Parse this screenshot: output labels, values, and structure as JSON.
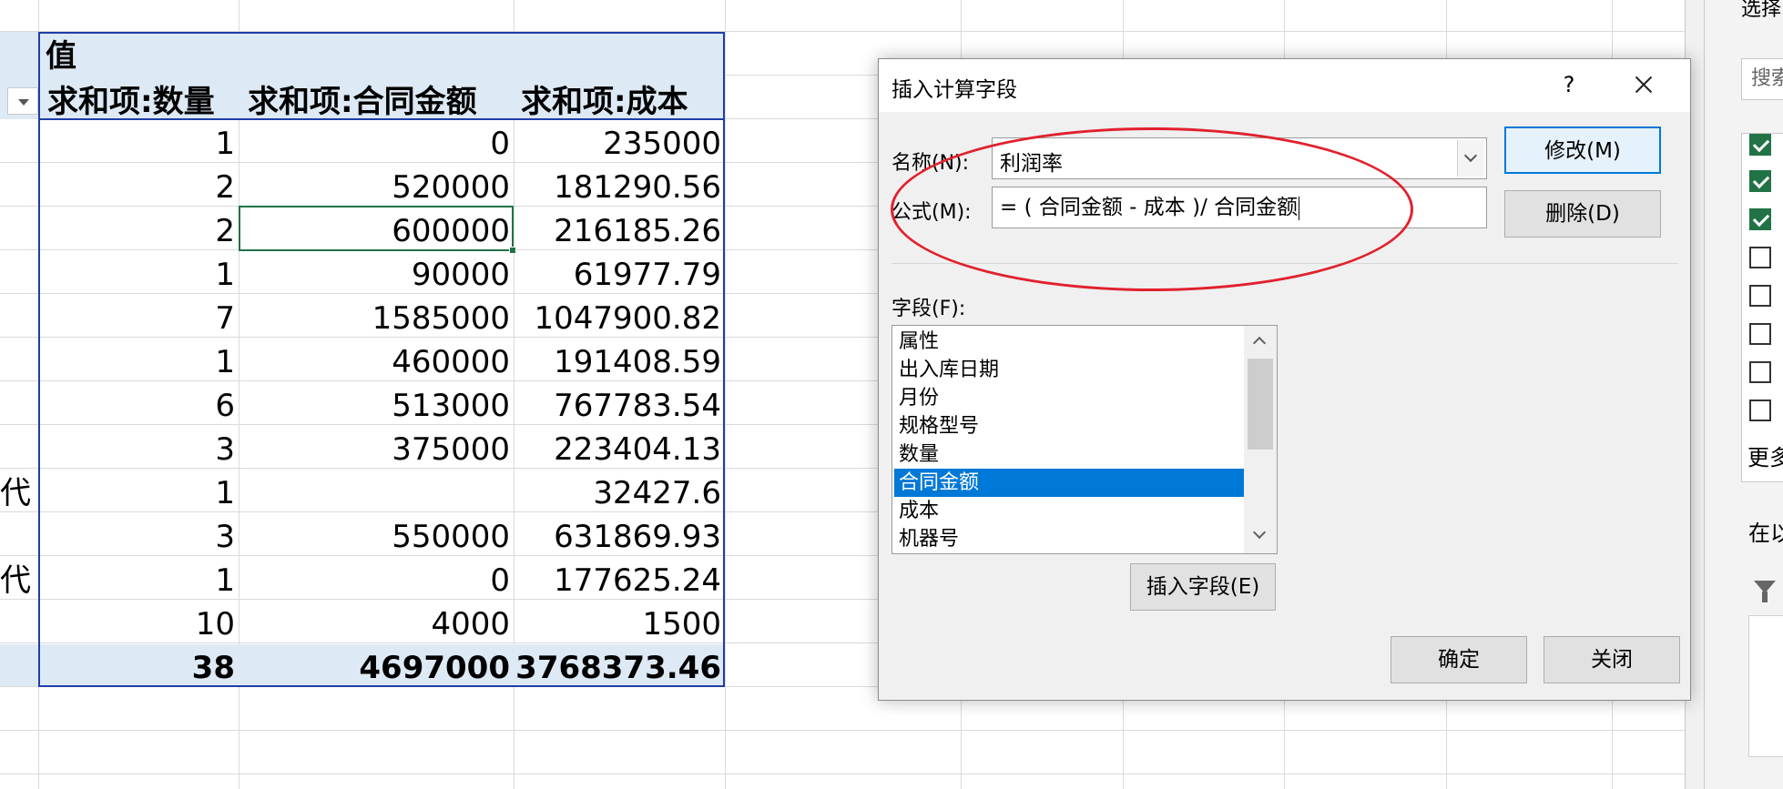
{
  "pivot": {
    "values_header": "值",
    "columns": [
      "求和项:数量",
      "求和项:合同金额",
      "求和项:成本"
    ],
    "rows": [
      {
        "label": "",
        "qty": "1",
        "amount": "0",
        "cost": "235000"
      },
      {
        "label": "",
        "qty": "2",
        "amount": "520000",
        "cost": "181290.56"
      },
      {
        "label": "",
        "qty": "2",
        "amount": "600000",
        "cost": "216185.26"
      },
      {
        "label": "",
        "qty": "1",
        "amount": "90000",
        "cost": "61977.79"
      },
      {
        "label": "",
        "qty": "7",
        "amount": "1585000",
        "cost": "1047900.82"
      },
      {
        "label": "",
        "qty": "1",
        "amount": "460000",
        "cost": "191408.59"
      },
      {
        "label": "",
        "qty": "6",
        "amount": "513000",
        "cost": "767783.54"
      },
      {
        "label": "",
        "qty": "3",
        "amount": "375000",
        "cost": "223404.13"
      },
      {
        "label": "代",
        "qty": "1",
        "amount": "",
        "cost": "32427.6"
      },
      {
        "label": "",
        "qty": "3",
        "amount": "550000",
        "cost": "631869.93"
      },
      {
        "label": "代",
        "qty": "1",
        "amount": "0",
        "cost": "177625.24"
      },
      {
        "label": "",
        "qty": "10",
        "amount": "4000",
        "cost": "1500"
      }
    ],
    "total": {
      "qty": "38",
      "amount": "4697000",
      "cost": "3768373.46"
    },
    "header_color": "#dde9f5",
    "border_color": "#1f3ea8"
  },
  "dialog": {
    "title": "插入计算字段",
    "help": "?",
    "name_label": "名称(N):",
    "name_value": "利润率",
    "formula_label": "公式(M):",
    "formula_value": "= ( 合同金额 - 成本 )/ 合同金额",
    "fields_label": "字段(F):",
    "fields": [
      "属性",
      "出入库日期",
      "月份",
      "规格型号",
      "数量",
      "合同金额",
      "成本",
      "机器号"
    ],
    "selected_field": "合同金额",
    "buttons": {
      "modify": "修改(M)",
      "delete": "删除(D)",
      "insert_field": "插入字段(E)",
      "ok": "确定",
      "close": "关闭"
    },
    "selection_color": "#0078d7"
  },
  "field_pane": {
    "title": "选择",
    "search_placeholder": "搜索",
    "checkboxes": [
      true,
      true,
      true,
      false,
      false,
      false,
      false,
      false
    ],
    "more_label": "更多",
    "area_label": "在以"
  },
  "annotation": {
    "color": "#e0212d"
  }
}
